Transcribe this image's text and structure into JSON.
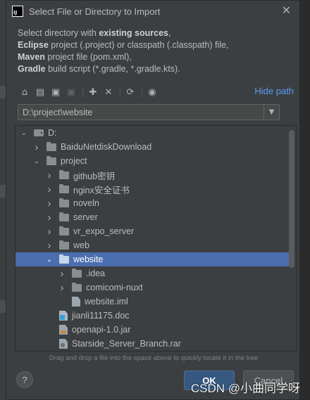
{
  "dialog": {
    "title": "Select File or Directory to Import",
    "app_icon_text": "IJ",
    "close_label": "✕",
    "description": [
      {
        "prefix": "Select directory with ",
        "bold": "existing sources",
        "suffix": ","
      },
      {
        "prefix": "",
        "bold": "Eclipse",
        "suffix": " project (.project) or classpath (.classpath) file,"
      },
      {
        "prefix": "",
        "bold": "Maven",
        "suffix": " project file (pom.xml),"
      },
      {
        "prefix": "",
        "bold": "Gradle",
        "suffix": " build script (*.gradle, *.gradle.kts)."
      }
    ]
  },
  "toolbar": {
    "icons": [
      "home-icon",
      "desktop-icon",
      "project-folder-icon",
      "module-folder-icon",
      "new-folder-icon",
      "delete-icon",
      "refresh-icon",
      "show-hidden-icon"
    ],
    "hide_path_label": "Hide path"
  },
  "path": {
    "value": "D:\\project\\website"
  },
  "tree": {
    "items": [
      {
        "label": "D:",
        "depth": 0,
        "expanded": true,
        "type": "drive"
      },
      {
        "label": "BaiduNetdiskDownload",
        "depth": 1,
        "expanded": false,
        "type": "folder"
      },
      {
        "label": "project",
        "depth": 1,
        "expanded": true,
        "type": "folder"
      },
      {
        "label": "github密钥",
        "depth": 2,
        "expanded": false,
        "type": "folder"
      },
      {
        "label": "nginx安全证书",
        "depth": 2,
        "expanded": false,
        "type": "folder"
      },
      {
        "label": "noveln",
        "depth": 2,
        "expanded": false,
        "type": "folder"
      },
      {
        "label": "server",
        "depth": 2,
        "expanded": false,
        "type": "folder"
      },
      {
        "label": "vr_expo_server",
        "depth": 2,
        "expanded": false,
        "type": "folder"
      },
      {
        "label": "web",
        "depth": 2,
        "expanded": false,
        "type": "folder"
      },
      {
        "label": "website",
        "depth": 2,
        "expanded": true,
        "type": "folder",
        "selected": true
      },
      {
        "label": ".idea",
        "depth": 3,
        "expanded": false,
        "type": "folder"
      },
      {
        "label": "comicomi-nuxt",
        "depth": 3,
        "expanded": false,
        "type": "folder"
      },
      {
        "label": "website.iml",
        "depth": 3,
        "type": "iml"
      },
      {
        "label": "jianli11175.doc",
        "depth": 2,
        "type": "doc"
      },
      {
        "label": "openapi-1.0.jar",
        "depth": 2,
        "type": "jar"
      },
      {
        "label": "Starside_Server_Branch.rar",
        "depth": 2,
        "type": "rar"
      }
    ]
  },
  "hint": "Drag and drop a file into the space above to quickly locate it in the tree",
  "buttons": {
    "help": "?",
    "ok": "OK",
    "cancel": "Cancel"
  },
  "watermark": "CSDN @小曲同学呀",
  "colors": {
    "selection": "#4b6eaf",
    "link": "#589df6",
    "dialog_bg": "#3c3f41"
  }
}
